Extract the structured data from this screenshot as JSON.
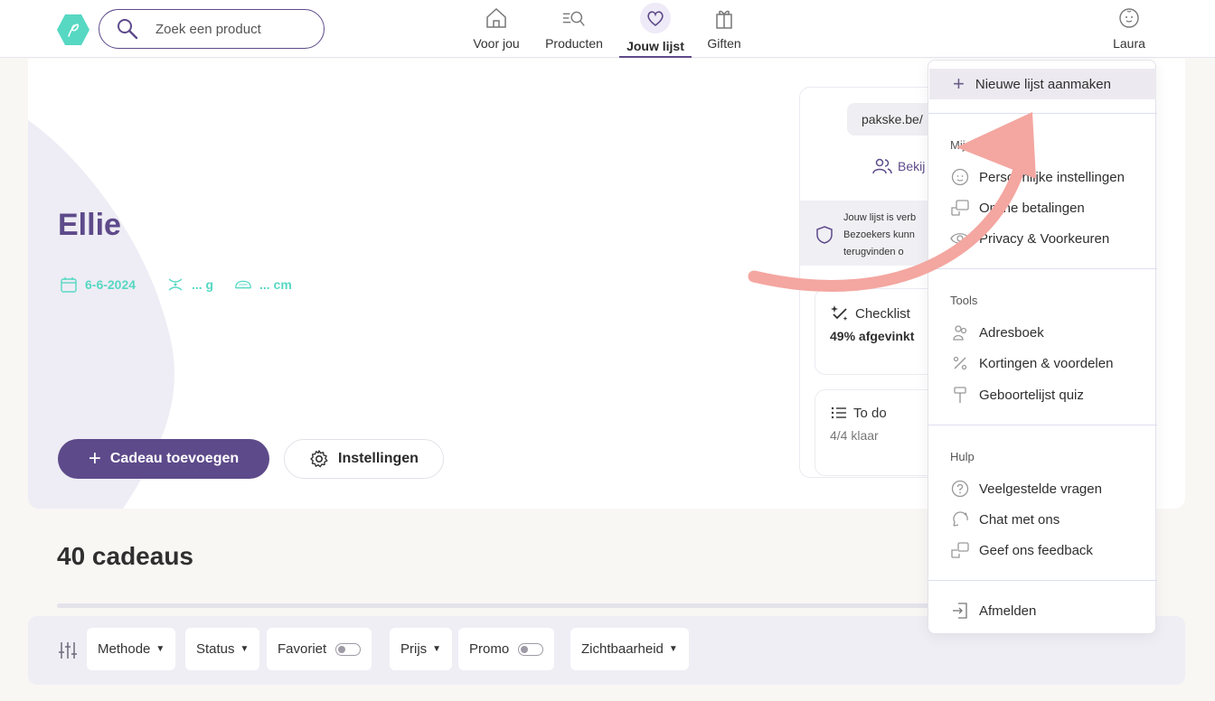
{
  "header": {
    "search_placeholder": "Zoek een product",
    "nav": [
      {
        "label": "Voor jou"
      },
      {
        "label": "Producten"
      },
      {
        "label": "Jouw lijst"
      },
      {
        "label": "Giften"
      }
    ],
    "user": "Laura"
  },
  "profile": {
    "name": "Ellie",
    "birth_date": "6-6-2024",
    "weight": "... g",
    "length": "... cm",
    "add_gift_label": "Cadeau toevoegen",
    "settings_label": "Instellingen"
  },
  "side_panel": {
    "share_url": "pakske.be/",
    "view_label": "Bekij",
    "privacy_line1": "Jouw lijst is verb",
    "privacy_line2": "Bezoekers kunn",
    "privacy_line3": "terugvinden o",
    "checklist_title": "Checklist",
    "checklist_progress": "49% afgevinkt",
    "todo_title": "To do",
    "todo_progress": "4/4 klaar"
  },
  "gifts": {
    "count_label": "40 cadeaus"
  },
  "filters": {
    "method": "Methode",
    "status": "Status",
    "favorite": "Favoriet",
    "price": "Prijs",
    "promo": "Promo",
    "visibility": "Zichtbaarheid"
  },
  "menu": {
    "new_list": "Nieuwe lijst aanmaken",
    "account_section": "Mijn account",
    "personal_settings": "Persoonlijke instellingen",
    "online_payments": "Online betalingen",
    "privacy": "Privacy & Voorkeuren",
    "tools_section": "Tools",
    "address_book": "Adresboek",
    "discounts": "Kortingen & voordelen",
    "quiz": "Geboortelijst quiz",
    "help_section": "Hulp",
    "faq": "Veelgestelde vragen",
    "chat": "Chat met ons",
    "feedback": "Geef ons feedback",
    "logout": "Afmelden"
  },
  "colors": {
    "brand": "#5d4a8a",
    "accent_teal": "#56d8c3",
    "annotation_arrow": "#f4a6a0"
  }
}
